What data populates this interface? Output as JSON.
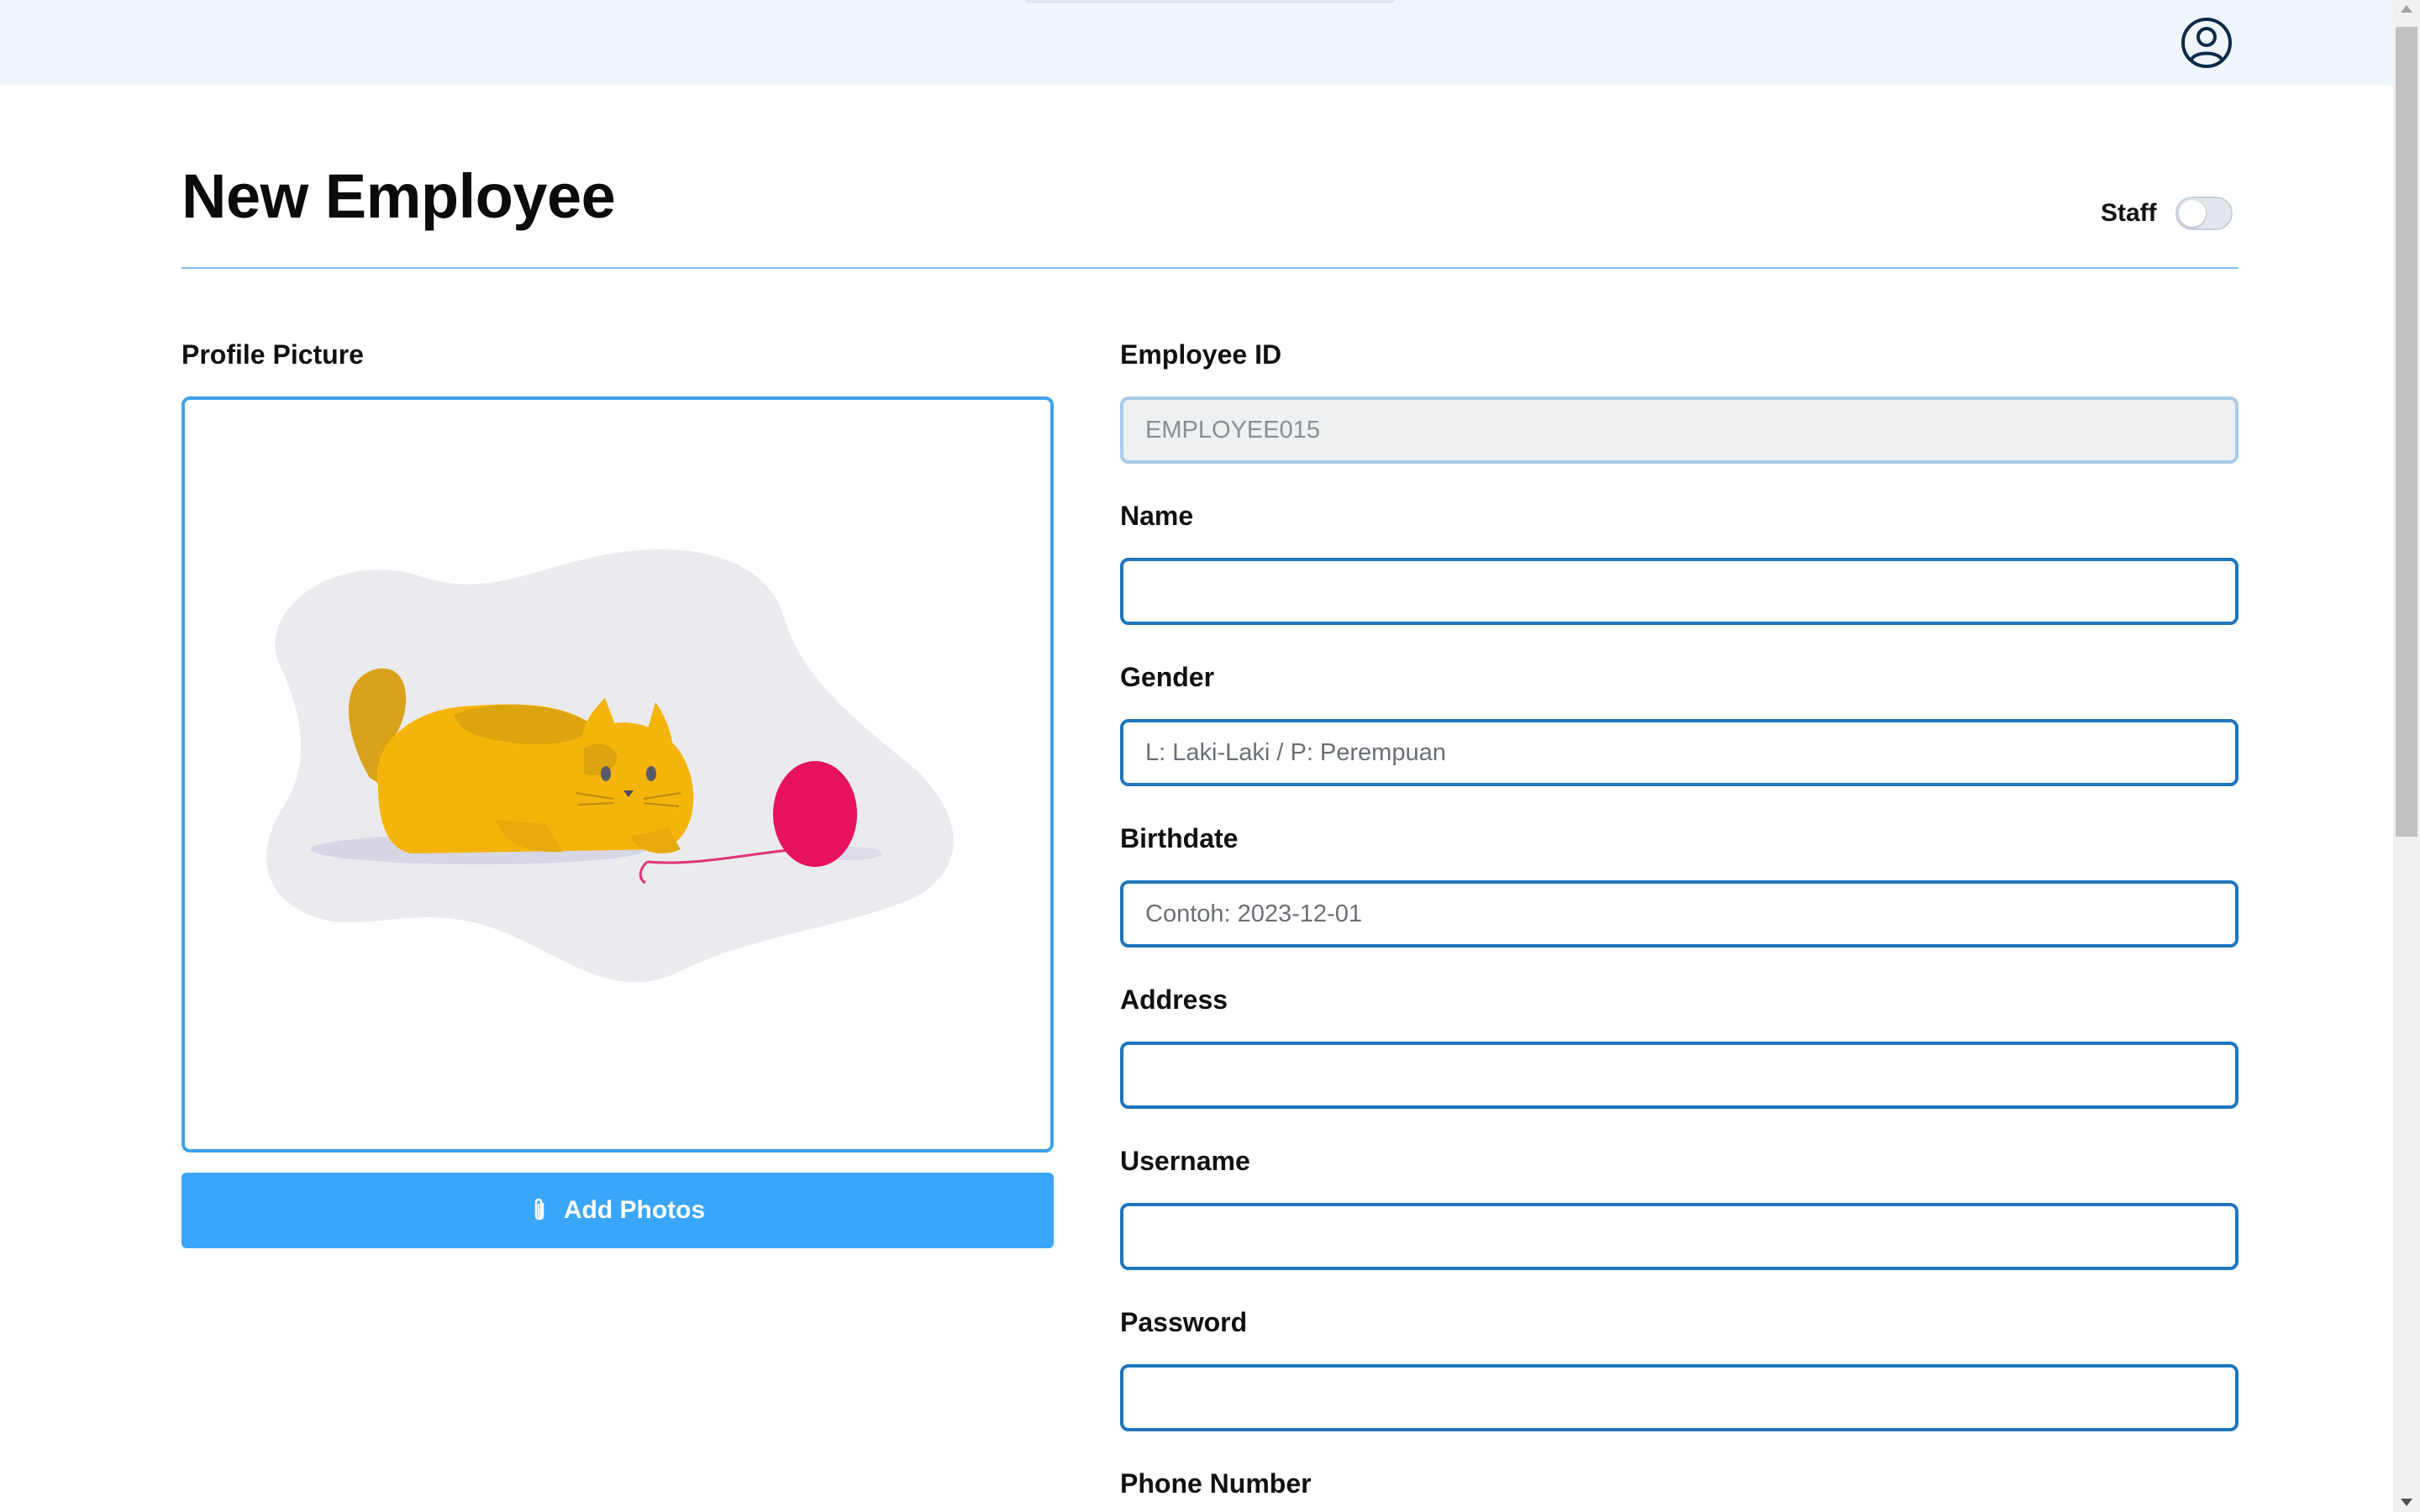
{
  "page": {
    "title": "New Employee"
  },
  "staff_toggle": {
    "label": "Staff",
    "checked": false
  },
  "profile_picture": {
    "label": "Profile Picture",
    "add_button_label": "Add Photos",
    "add_button_icon": "paperclip-icon",
    "placeholder_image": "cat-playing-with-yarn-illustration"
  },
  "form": {
    "employee_id": {
      "label": "Employee ID",
      "value": "EMPLOYEE015",
      "disabled": true
    },
    "name": {
      "label": "Name",
      "value": "",
      "placeholder": ""
    },
    "gender": {
      "label": "Gender",
      "value": "",
      "placeholder": "L: Laki-Laki / P: Perempuan"
    },
    "birthdate": {
      "label": "Birthdate",
      "value": "",
      "placeholder": "Contoh: 2023-12-01"
    },
    "address": {
      "label": "Address",
      "value": "",
      "placeholder": ""
    },
    "username": {
      "label": "Username",
      "value": "",
      "placeholder": ""
    },
    "password": {
      "label": "Password",
      "value": "",
      "placeholder": ""
    },
    "phone_number": {
      "label": "Phone Number"
    }
  },
  "header": {
    "profile_icon": "user-circle-icon"
  },
  "colors": {
    "accent": "#3aa6fa",
    "input_border": "#1e76bd",
    "topbar_bg": "#eff6fc",
    "divider": "#7fbde6"
  }
}
